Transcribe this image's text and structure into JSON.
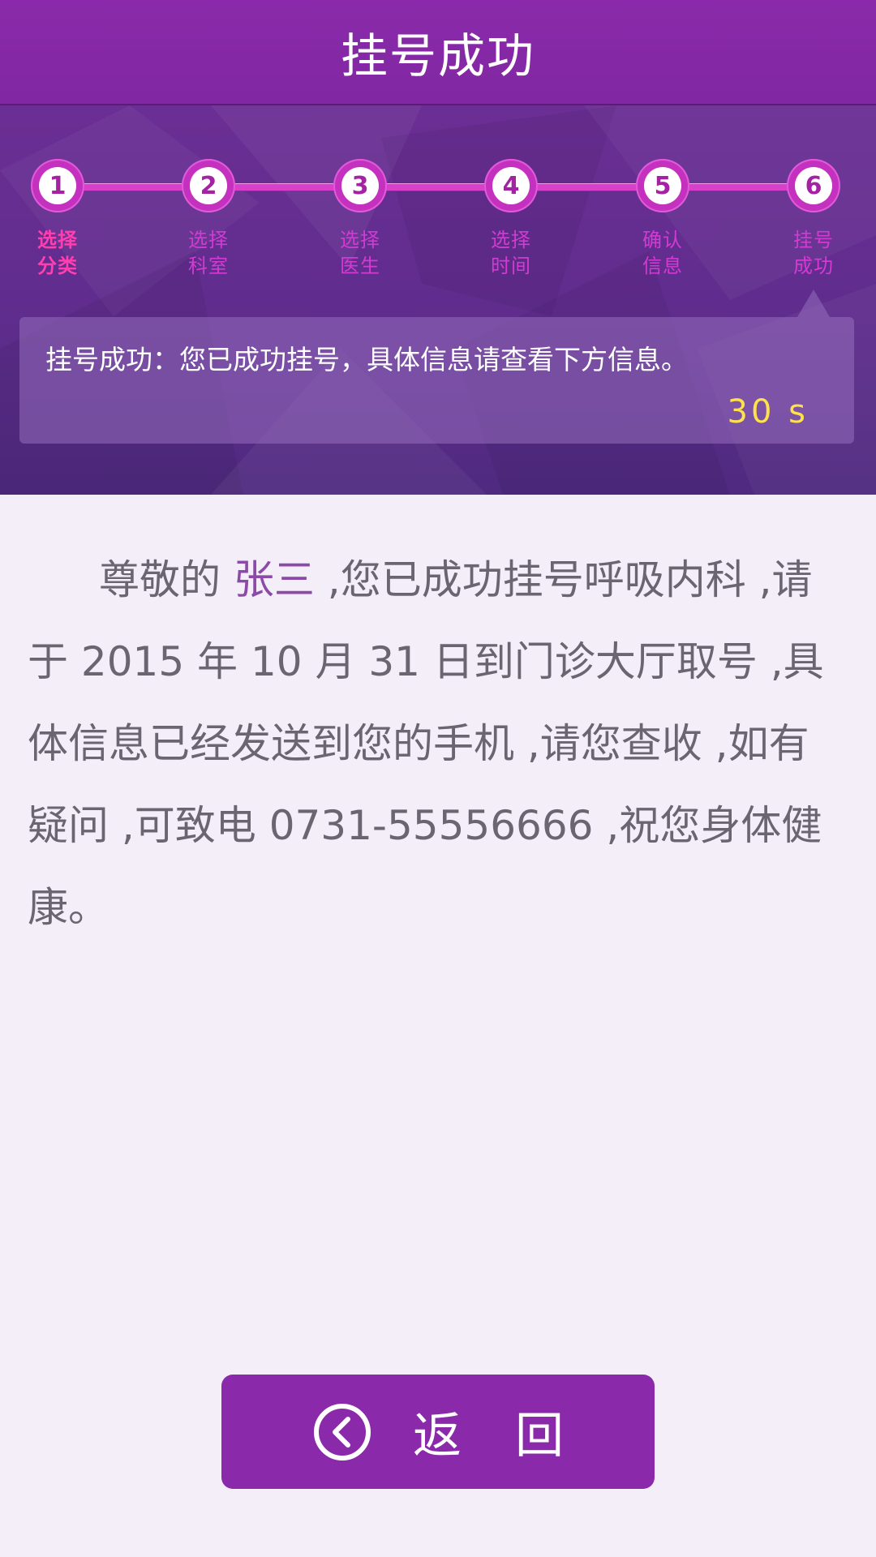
{
  "header": {
    "title": "挂号成功"
  },
  "steps": [
    {
      "number": "1",
      "line1": "选择",
      "line2": "分类",
      "active": true
    },
    {
      "number": "2",
      "line1": "选择",
      "line2": "科室",
      "active": false
    },
    {
      "number": "3",
      "line1": "选择",
      "line2": "医生",
      "active": false
    },
    {
      "number": "4",
      "line1": "选择",
      "line2": "时间",
      "active": false
    },
    {
      "number": "5",
      "line1": "确认",
      "line2": "信息",
      "active": false
    },
    {
      "number": "6",
      "line1": "挂号",
      "line2": "成功",
      "active": false
    }
  ],
  "notice": {
    "text": "挂号成功：您已成功挂号，具体信息请查看下方信息。",
    "countdown": "30 s"
  },
  "message": {
    "greeting": "尊敬的 ",
    "patient_name": "张三",
    "part1": "  ,您已成功挂号呼吸内科 ,请于 ",
    "year": "2015",
    "part2": " 年 ",
    "month": "10",
    "part3": " 月 ",
    "day": "31",
    "part4": " 日到门诊大厅取号 ,具体信息已经发送到您的手机 ,请您查收 ,如有疑问 ,可致电 ",
    "phone": "0731-55556666",
    "part5": " ,祝您身体健康。"
  },
  "actions": {
    "back_label": "返回",
    "back_icon": "chevron-left-circle-icon"
  },
  "colors": {
    "brand_purple": "#8a2aaa",
    "step_pink": "#d33ad1",
    "active_step": "#ff3fb0",
    "countdown_yellow": "#ffe24a",
    "body_text": "#6a6570",
    "page_background": "#f4eef8"
  }
}
